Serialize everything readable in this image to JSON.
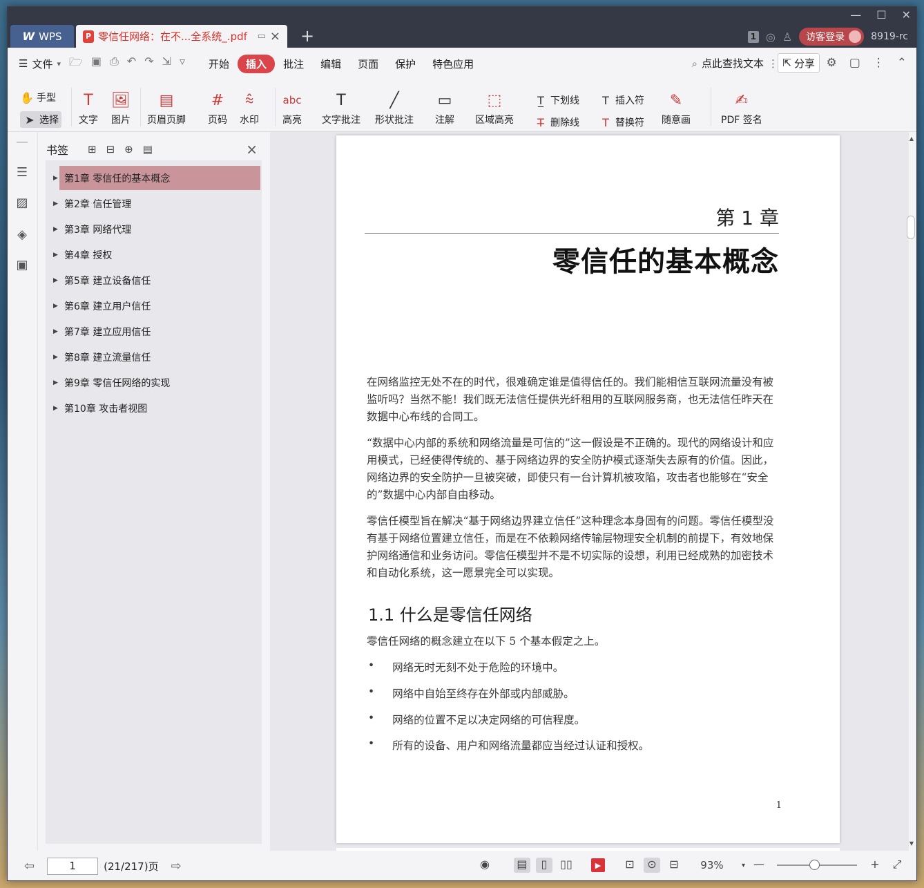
{
  "titlebar": {
    "app_tab_label": "WPS",
    "doc_tab_title": "零信任网络：在不...全系统_.pdf",
    "window_badge": "1",
    "login_label": "访客登录",
    "user_id": "8919-rc"
  },
  "menubar": {
    "file_label": "文件",
    "items": [
      "开始",
      "插入",
      "批注",
      "编辑",
      "页面",
      "保护",
      "特色应用"
    ],
    "active_item": "插入",
    "search_label": "点此查找文本",
    "share_label": "分享"
  },
  "toolbar": {
    "hand_label": "手型",
    "select_label": "选择",
    "text_label": "文字",
    "image_label": "图片",
    "header_footer_label": "页眉页脚",
    "page_number_label": "页码",
    "watermark_label": "水印",
    "highlight_label": "高亮",
    "text_comment_label": "文字批注",
    "shape_comment_label": "形状批注",
    "note_label": "注解",
    "area_highlight_label": "区域高亮",
    "underline_label": "下划线",
    "strikethrough_label": "删除线",
    "insert_mark_label": "插入符",
    "replace_mark_label": "替换符",
    "freehand_label": "随意画",
    "pdf_sign_label": "PDF 签名"
  },
  "bookmarks": {
    "title": "书签",
    "items": [
      {
        "label": "第1章  零信任的基本概念"
      },
      {
        "label": "第2章  信任管理"
      },
      {
        "label": "第3章  网络代理"
      },
      {
        "label": "第4章  授权"
      },
      {
        "label": "第5章  建立设备信任"
      },
      {
        "label": "第6章  建立用户信任"
      },
      {
        "label": "第7章  建立应用信任"
      },
      {
        "label": "第8章  建立流量信任"
      },
      {
        "label": "第9章  零信任网络的实现"
      },
      {
        "label": "第10章  攻击者视图"
      }
    ],
    "selected_index": 0
  },
  "page": {
    "chapter_no": "第 1 章",
    "chapter_title": "零信任的基本概念",
    "para1": "在网络监控无处不在的时代，很难确定谁是值得信任的。我们能相信互联网流量没有被监听吗？当然不能！我们既无法信任提供光纤租用的互联网服务商，也无法信任昨天在数据中心布线的合同工。",
    "para2": "“数据中心内部的系统和网络流量是可信的”这一假设是不正确的。现代的网络设计和应用模式，已经使得传统的、基于网络边界的安全防护模式逐渐失去原有的价值。因此，网络边界的安全防护一旦被突破，即使只有一台计算机被攻陷，攻击者也能够在“安全的”数据中心内部自由移动。",
    "para3": "零信任模型旨在解决“基于网络边界建立信任”这种理念本身固有的问题。零信任模型没有基于网络位置建立信任，而是在不依赖网络传输层物理安全机制的前提下，有效地保护网络通信和业务访问。零信任模型并不是不切实际的设想，利用已经成熟的加密技术和自动化系统，这一愿景完全可以实现。",
    "section_title": "1.1    什么是零信任网络",
    "section_intro": "零信任网络的概念建立在以下 5 个基本假定之上。",
    "bullets": [
      "网络无时无刻不处于危险的环境中。",
      "网络中自始至终存在外部或内部威胁。",
      "网络的位置不足以决定网络的可信程度。",
      "所有的设备、用户和网络流量都应当经过认证和授权。"
    ],
    "page_number": "1"
  },
  "statusbar": {
    "page_input": "1",
    "page_info": "(21/217)页",
    "zoom": "93%"
  }
}
